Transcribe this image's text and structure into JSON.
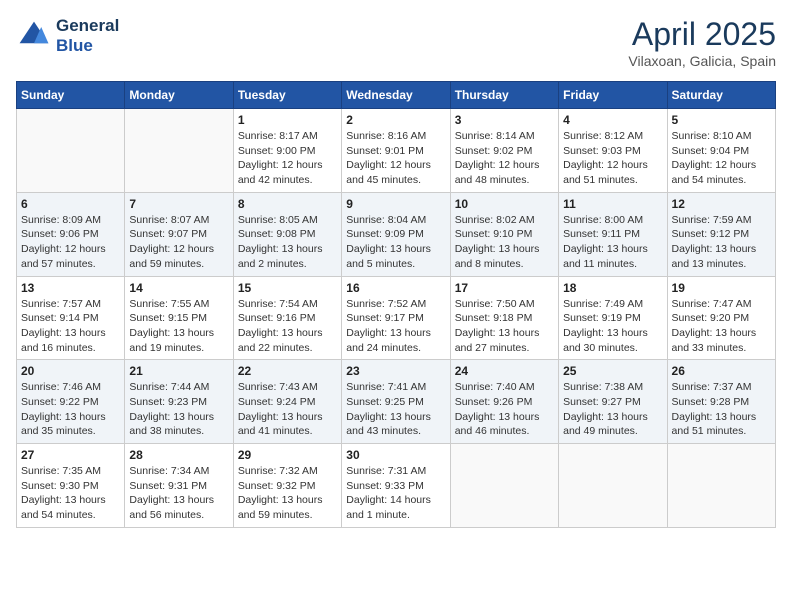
{
  "header": {
    "logo_line1": "General",
    "logo_line2": "Blue",
    "month": "April 2025",
    "location": "Vilaxoan, Galicia, Spain"
  },
  "days_of_week": [
    "Sunday",
    "Monday",
    "Tuesday",
    "Wednesday",
    "Thursday",
    "Friday",
    "Saturday"
  ],
  "weeks": [
    [
      {
        "day": "",
        "content": ""
      },
      {
        "day": "",
        "content": ""
      },
      {
        "day": "1",
        "content": "Sunrise: 8:17 AM\nSunset: 9:00 PM\nDaylight: 12 hours and 42 minutes."
      },
      {
        "day": "2",
        "content": "Sunrise: 8:16 AM\nSunset: 9:01 PM\nDaylight: 12 hours and 45 minutes."
      },
      {
        "day": "3",
        "content": "Sunrise: 8:14 AM\nSunset: 9:02 PM\nDaylight: 12 hours and 48 minutes."
      },
      {
        "day": "4",
        "content": "Sunrise: 8:12 AM\nSunset: 9:03 PM\nDaylight: 12 hours and 51 minutes."
      },
      {
        "day": "5",
        "content": "Sunrise: 8:10 AM\nSunset: 9:04 PM\nDaylight: 12 hours and 54 minutes."
      }
    ],
    [
      {
        "day": "6",
        "content": "Sunrise: 8:09 AM\nSunset: 9:06 PM\nDaylight: 12 hours and 57 minutes."
      },
      {
        "day": "7",
        "content": "Sunrise: 8:07 AM\nSunset: 9:07 PM\nDaylight: 12 hours and 59 minutes."
      },
      {
        "day": "8",
        "content": "Sunrise: 8:05 AM\nSunset: 9:08 PM\nDaylight: 13 hours and 2 minutes."
      },
      {
        "day": "9",
        "content": "Sunrise: 8:04 AM\nSunset: 9:09 PM\nDaylight: 13 hours and 5 minutes."
      },
      {
        "day": "10",
        "content": "Sunrise: 8:02 AM\nSunset: 9:10 PM\nDaylight: 13 hours and 8 minutes."
      },
      {
        "day": "11",
        "content": "Sunrise: 8:00 AM\nSunset: 9:11 PM\nDaylight: 13 hours and 11 minutes."
      },
      {
        "day": "12",
        "content": "Sunrise: 7:59 AM\nSunset: 9:12 PM\nDaylight: 13 hours and 13 minutes."
      }
    ],
    [
      {
        "day": "13",
        "content": "Sunrise: 7:57 AM\nSunset: 9:14 PM\nDaylight: 13 hours and 16 minutes."
      },
      {
        "day": "14",
        "content": "Sunrise: 7:55 AM\nSunset: 9:15 PM\nDaylight: 13 hours and 19 minutes."
      },
      {
        "day": "15",
        "content": "Sunrise: 7:54 AM\nSunset: 9:16 PM\nDaylight: 13 hours and 22 minutes."
      },
      {
        "day": "16",
        "content": "Sunrise: 7:52 AM\nSunset: 9:17 PM\nDaylight: 13 hours and 24 minutes."
      },
      {
        "day": "17",
        "content": "Sunrise: 7:50 AM\nSunset: 9:18 PM\nDaylight: 13 hours and 27 minutes."
      },
      {
        "day": "18",
        "content": "Sunrise: 7:49 AM\nSunset: 9:19 PM\nDaylight: 13 hours and 30 minutes."
      },
      {
        "day": "19",
        "content": "Sunrise: 7:47 AM\nSunset: 9:20 PM\nDaylight: 13 hours and 33 minutes."
      }
    ],
    [
      {
        "day": "20",
        "content": "Sunrise: 7:46 AM\nSunset: 9:22 PM\nDaylight: 13 hours and 35 minutes."
      },
      {
        "day": "21",
        "content": "Sunrise: 7:44 AM\nSunset: 9:23 PM\nDaylight: 13 hours and 38 minutes."
      },
      {
        "day": "22",
        "content": "Sunrise: 7:43 AM\nSunset: 9:24 PM\nDaylight: 13 hours and 41 minutes."
      },
      {
        "day": "23",
        "content": "Sunrise: 7:41 AM\nSunset: 9:25 PM\nDaylight: 13 hours and 43 minutes."
      },
      {
        "day": "24",
        "content": "Sunrise: 7:40 AM\nSunset: 9:26 PM\nDaylight: 13 hours and 46 minutes."
      },
      {
        "day": "25",
        "content": "Sunrise: 7:38 AM\nSunset: 9:27 PM\nDaylight: 13 hours and 49 minutes."
      },
      {
        "day": "26",
        "content": "Sunrise: 7:37 AM\nSunset: 9:28 PM\nDaylight: 13 hours and 51 minutes."
      }
    ],
    [
      {
        "day": "27",
        "content": "Sunrise: 7:35 AM\nSunset: 9:30 PM\nDaylight: 13 hours and 54 minutes."
      },
      {
        "day": "28",
        "content": "Sunrise: 7:34 AM\nSunset: 9:31 PM\nDaylight: 13 hours and 56 minutes."
      },
      {
        "day": "29",
        "content": "Sunrise: 7:32 AM\nSunset: 9:32 PM\nDaylight: 13 hours and 59 minutes."
      },
      {
        "day": "30",
        "content": "Sunrise: 7:31 AM\nSunset: 9:33 PM\nDaylight: 14 hours and 1 minute."
      },
      {
        "day": "",
        "content": ""
      },
      {
        "day": "",
        "content": ""
      },
      {
        "day": "",
        "content": ""
      }
    ]
  ]
}
